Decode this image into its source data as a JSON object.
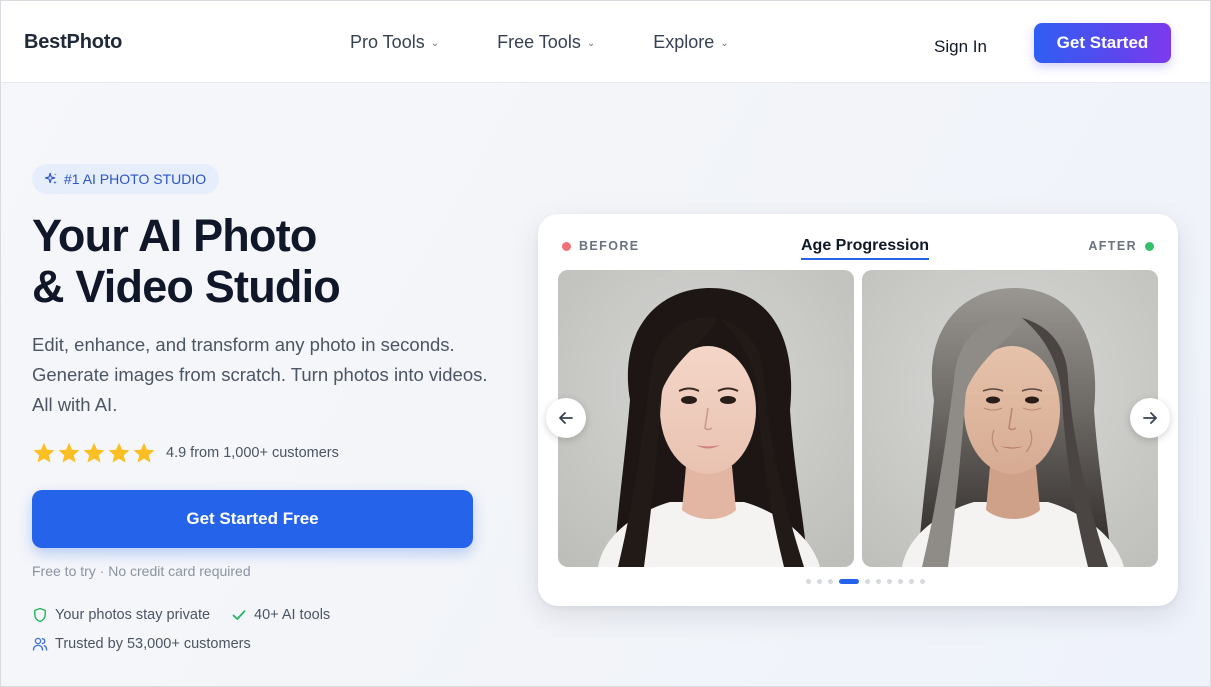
{
  "nav": {
    "logo": "BestPhoto",
    "items": [
      {
        "label": "Pro Tools"
      },
      {
        "label": "Free Tools"
      },
      {
        "label": "Explore"
      }
    ],
    "sign_in": "Sign In",
    "cta": "Get Started"
  },
  "hero": {
    "badge": "#1 AI PHOTO STUDIO",
    "title_line1": "Your AI Photo",
    "title_line2": "& Video Studio",
    "subtitle": "Edit, enhance, and transform any photo in seconds. Generate images from scratch. Turn photos into videos. All with AI.",
    "rating_value": 5,
    "rating_text": "4.9 from 1,000+ customers",
    "cta": "Get Started Free",
    "note": "Free to try · No credit card required",
    "trust": {
      "private": "Your photos stay private",
      "tools": "40+ AI tools",
      "trusted": "Trusted by 53,000+ customers"
    }
  },
  "showcase": {
    "before_label": "BEFORE",
    "after_label": "AFTER",
    "title": "Age Progression",
    "slide_count": 10,
    "active_slide": 4
  },
  "colors": {
    "accent": "#2563eb",
    "before_dot": "#f07178",
    "after_dot": "#34c06b",
    "star": "#fbbf24"
  }
}
